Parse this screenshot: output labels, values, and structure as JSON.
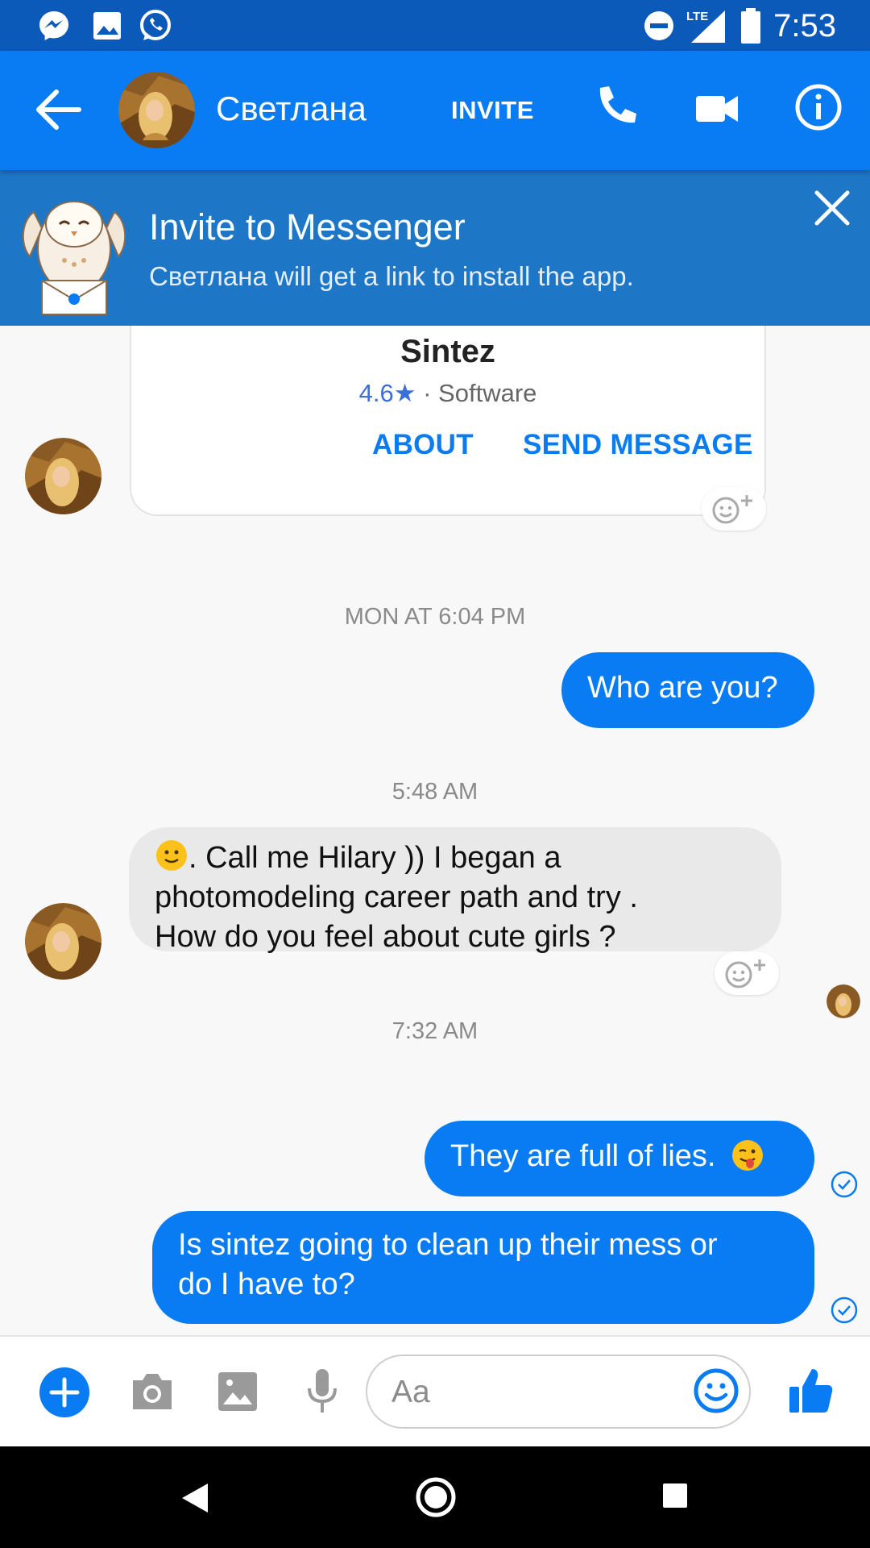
{
  "status_bar": {
    "time": "7:53",
    "network": "LTE",
    "icons": [
      "messenger-icon",
      "image-icon",
      "whatsapp-icon",
      "do-not-disturb-icon",
      "signal-icon",
      "battery-icon"
    ]
  },
  "header": {
    "contact_name": "Светлана",
    "invite_label": "INVITE",
    "icons": [
      "back-arrow-icon",
      "phone-icon",
      "video-camera-icon",
      "info-icon"
    ]
  },
  "invite_banner": {
    "title": "Invite to Messenger",
    "subtitle": "Светлана will get a link to install the app."
  },
  "card": {
    "title": "Sintez",
    "rating": "4.6",
    "category": "· Software",
    "about_label": "ABOUT",
    "send_message_label": "SEND MESSAGE"
  },
  "messages": [
    {
      "type": "timestamp",
      "text": "MON AT 6:04 PM"
    },
    {
      "type": "outgoing",
      "text": "Who are you?"
    },
    {
      "type": "timestamp",
      "text": "5:48 AM"
    },
    {
      "type": "incoming",
      "lines": [
        ". Call me Hilary )) I began a",
        "photomodeling career path and try  .",
        "How do you feel about cute girls ?"
      ]
    },
    {
      "type": "timestamp",
      "text": "7:32 AM"
    },
    {
      "type": "outgoing",
      "text": "They are full of lies."
    },
    {
      "type": "outgoing",
      "lines": [
        "Is sintez going to clean up their mess or",
        "do I have to?"
      ]
    }
  ],
  "composer": {
    "placeholder": "Aa",
    "icons": [
      "plus-icon",
      "camera-icon",
      "gallery-icon",
      "microphone-icon",
      "emoji-icon",
      "thumbs-up-icon"
    ]
  },
  "colors": {
    "status_bar": "#0b59b9",
    "header": "#0a7cf3",
    "banner": "#1e76c7",
    "outgoing_bubble": "#0a7cf3",
    "incoming_bubble": "#e9e9e9"
  }
}
